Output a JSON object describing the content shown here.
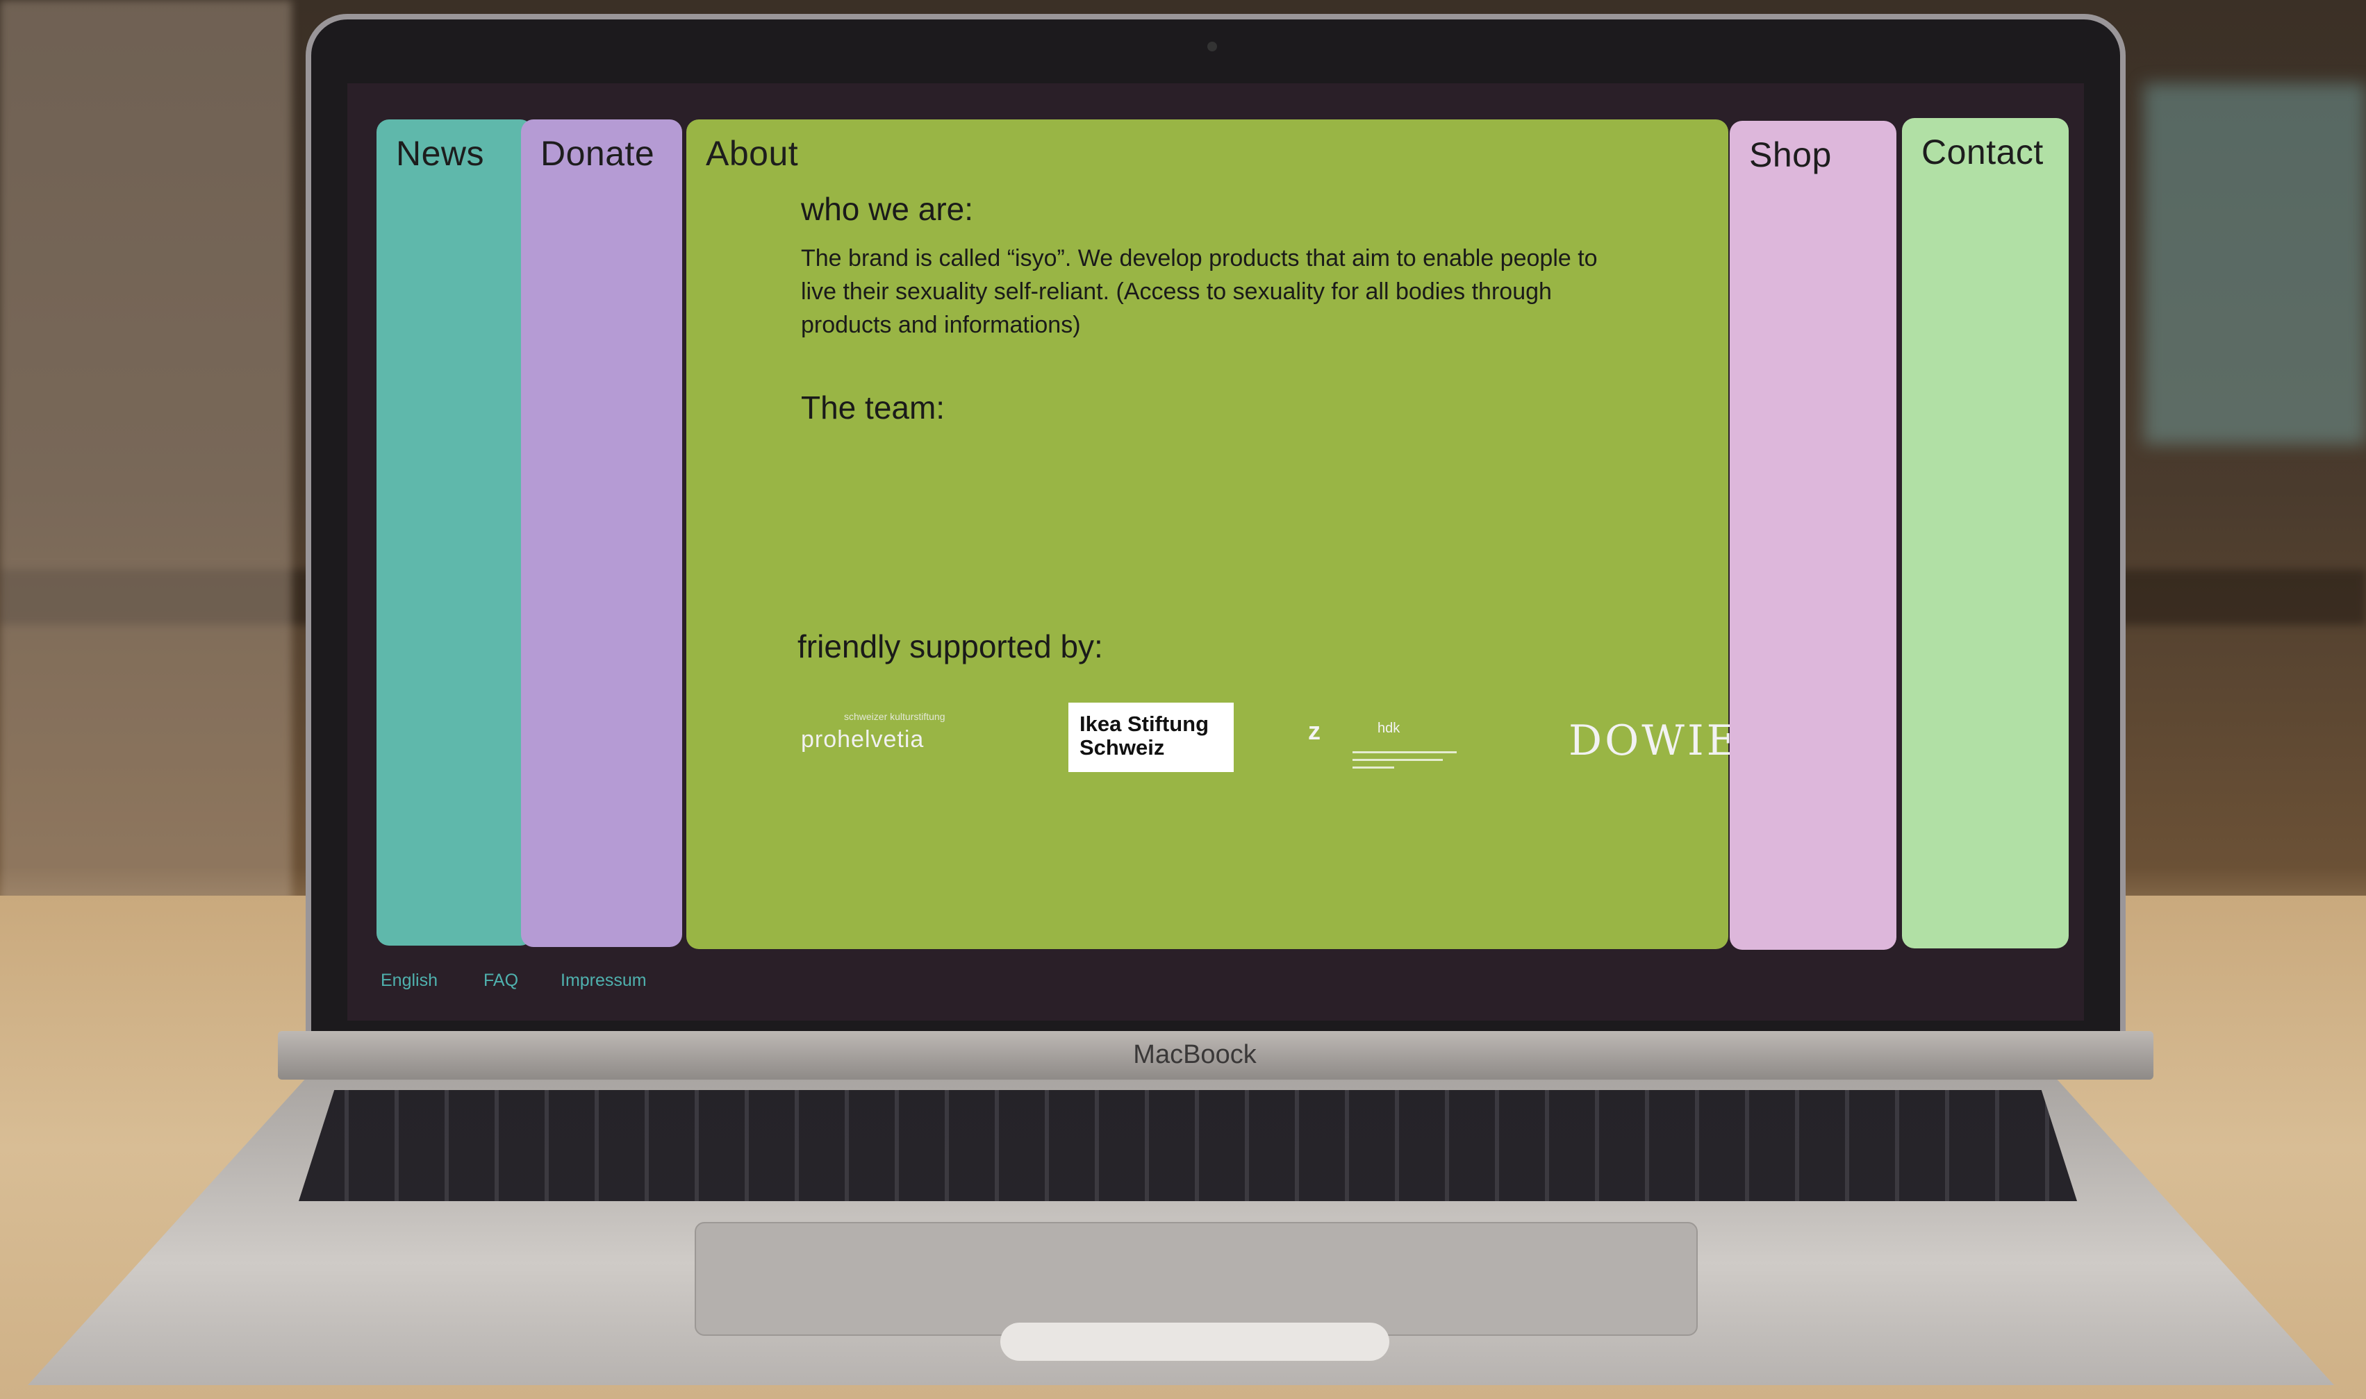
{
  "nav": {
    "news": "News",
    "donate": "Donate",
    "about": "About",
    "shop": "Shop",
    "contact": "Contact"
  },
  "about": {
    "heading": "who we are:",
    "text": "The brand is called “isyo”. We develop products that aim to enable people to live their sexuality self-reliant. (Access to sexuality for all bodies through products and informations)",
    "team_heading": "The team:",
    "support_heading": "friendly supported by:"
  },
  "sponsors": {
    "prohelvetia_small": "schweizer kulturstiftung",
    "prohelvetia": "prohelvetia",
    "ikea_line1": "Ikea Stiftung",
    "ikea_line2": "Schweiz",
    "zhdk_mark": "z",
    "zhdk_name": "hdk",
    "dowie": "DOWIE"
  },
  "footer": {
    "english": "English",
    "faq": "FAQ",
    "impressum": "Impressum"
  },
  "laptop": {
    "brand": "MacBoock"
  },
  "colors": {
    "news": "#5fb8ab",
    "donate": "#b59bd4",
    "about": "#99b545",
    "shop": "#ddb7db",
    "contact": "#b1e0a5",
    "footer_link": "#4fb1ae"
  }
}
